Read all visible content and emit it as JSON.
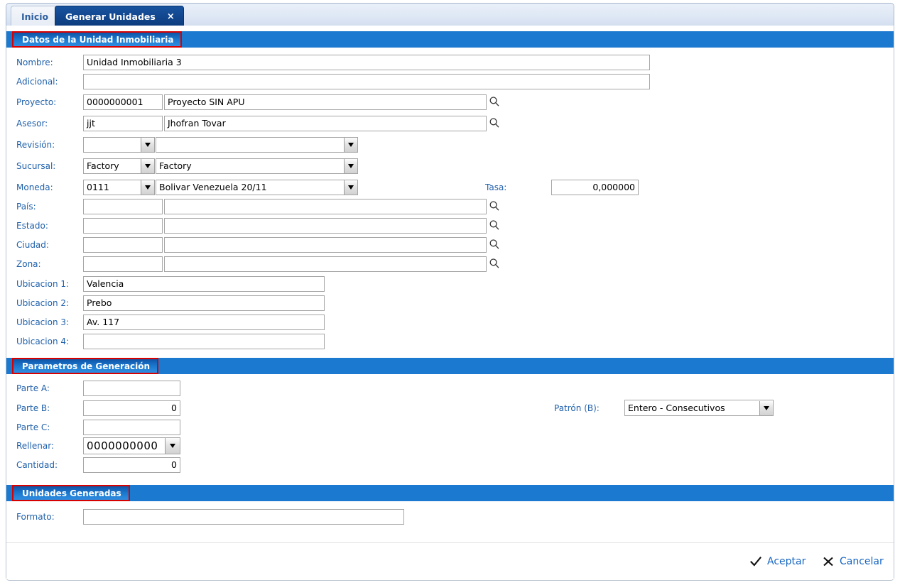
{
  "tabs": [
    {
      "label": "Inicio",
      "active": false
    },
    {
      "label": "Generar Unidades",
      "active": true,
      "close": "×"
    }
  ],
  "sections": {
    "datos": {
      "title": "Datos de la Unidad Inmobiliaria"
    },
    "parametros": {
      "title": "Parametros de Generación"
    },
    "unidades": {
      "title": "Unidades Generadas"
    }
  },
  "form": {
    "nombre": {
      "label": "Nombre:",
      "value": "Unidad Inmobiliaria 3"
    },
    "adicional": {
      "label": "Adicional:",
      "value": ""
    },
    "proyecto": {
      "label": "Proyecto:",
      "code": "0000000001",
      "name": "Proyecto SIN APU",
      "lookup": "search-icon"
    },
    "asesor": {
      "label": "Asesor:",
      "code": "jjt",
      "name": "Jhofran Tovar",
      "lookup": "search-icon"
    },
    "revision": {
      "label": "Revisión:",
      "code": "",
      "name": ""
    },
    "sucursal": {
      "label": "Sucursal:",
      "code": "Factory",
      "name": "Factory"
    },
    "moneda": {
      "label": "Moneda:",
      "code": "0111",
      "name": "Bolivar Venezuela 20/11"
    },
    "tasa": {
      "label": "Tasa:",
      "value": "0,000000"
    },
    "pais": {
      "label": "País:",
      "code": "",
      "name": "",
      "lookup": "search-icon"
    },
    "estado": {
      "label": "Estado:",
      "code": "",
      "name": "",
      "lookup": "search-icon"
    },
    "ciudad": {
      "label": "Ciudad:",
      "code": "",
      "name": "",
      "lookup": "search-icon"
    },
    "zona": {
      "label": "Zona:",
      "code": "",
      "name": "",
      "lookup": "search-icon"
    },
    "ubicacion1": {
      "label": "Ubicacion 1:",
      "value": "Valencia"
    },
    "ubicacion2": {
      "label": "Ubicacion 2:",
      "value": "Prebo"
    },
    "ubicacion3": {
      "label": "Ubicacion 3:",
      "value": "Av. 117"
    },
    "ubicacion4": {
      "label": "Ubicacion 4:",
      "value": ""
    }
  },
  "parametros": {
    "parteA": {
      "label": "Parte A:",
      "value": ""
    },
    "parteB": {
      "label": "Parte B:",
      "value": "0"
    },
    "parteC": {
      "label": "Parte C:",
      "value": ""
    },
    "rellenar": {
      "label": "Rellenar:",
      "value": "0000000000"
    },
    "cantidad": {
      "label": "Cantidad:",
      "value": "0"
    },
    "patron": {
      "label": "Patrón (B):",
      "value": "Entero - Consecutivos"
    }
  },
  "unidades": {
    "formato": {
      "label": "Formato:",
      "value": ""
    }
  },
  "footer": {
    "accept": {
      "label": "Aceptar",
      "icon": "check-icon"
    },
    "cancel": {
      "label": "Cancelar",
      "icon": "close-icon"
    }
  },
  "colors": {
    "section_bar": "#1b79d0",
    "active_tab": "#0e3f86",
    "label_blue": "#1f60ab",
    "annotation_red": "#d60000",
    "link_blue": "#1565c0"
  }
}
